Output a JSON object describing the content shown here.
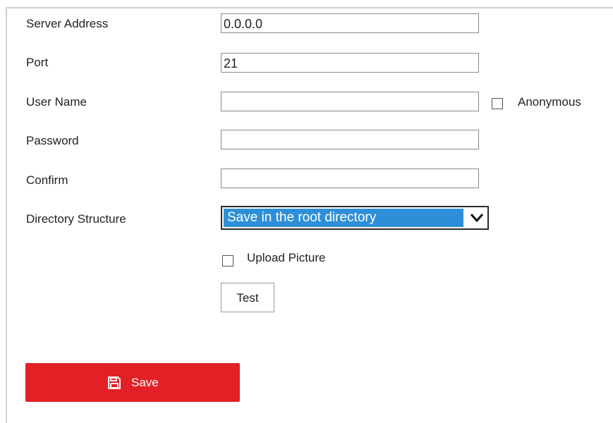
{
  "form": {
    "server_address": {
      "label": "Server Address",
      "value": "0.0.0.0"
    },
    "port": {
      "label": "Port",
      "value": "21"
    },
    "user_name": {
      "label": "User Name",
      "value": ""
    },
    "anonymous": {
      "label": "Anonymous",
      "checked": false
    },
    "password": {
      "label": "Password",
      "value": ""
    },
    "confirm": {
      "label": "Confirm",
      "value": ""
    },
    "directory_structure": {
      "label": "Directory Structure",
      "selected": "Save in the root directory",
      "icon": "chevron-down-icon"
    },
    "upload_picture": {
      "label": "Upload Picture",
      "checked": false
    }
  },
  "buttons": {
    "test_label": "Test",
    "save_label": "Save",
    "save_icon": "floppy-disk-icon"
  },
  "colors": {
    "save_button": "#e32026",
    "select_highlight": "#2e8fd8"
  }
}
